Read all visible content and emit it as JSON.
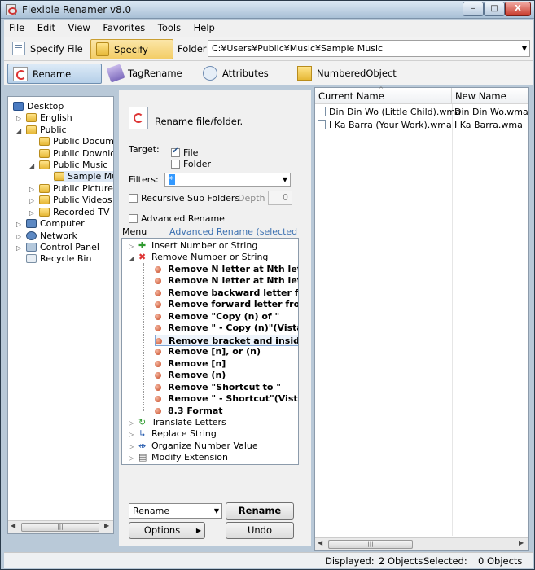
{
  "window": {
    "title": "Flexible Renamer v8.0",
    "min": "–",
    "max": "□",
    "close": "X"
  },
  "menubar": [
    "File",
    "Edit",
    "View",
    "Favorites",
    "Tools",
    "Help"
  ],
  "toolbar": {
    "specify_file": "Specify File",
    "specify_folder": "Specify Folder",
    "folder_label": "Folder",
    "path": "C:¥Users¥Public¥Music¥Sample Music"
  },
  "tabs": [
    "Rename",
    "TagRename",
    "Attributes",
    "NumberedObject"
  ],
  "tree": [
    "Desktop",
    "English",
    "Public",
    "Public Docume",
    "Public Downlo",
    "Public Music",
    "Sample Mu",
    "Public Pictures",
    "Public Videos",
    "Recorded TV",
    "Computer",
    "Network",
    "Control Panel",
    "Recycle Bin"
  ],
  "panel": {
    "header": "Rename file/folder.",
    "target_label": "Target:",
    "target_file": "File",
    "target_folder": "Folder",
    "filters_label": "Filters:",
    "filters_value": "*",
    "recursive": "Recursive Sub Folders",
    "depth_label": "Depth",
    "depth_value": "0",
    "advanced": "Advanced Rename",
    "menu_label": "Menu",
    "menu_selected": "Advanced Rename (selected item)"
  },
  "menu_tree": {
    "insert": "Insert Number or String",
    "remove": "Remove Number or String",
    "remove_items": [
      "Remove N letter at Nth letter",
      "Remove N letter at Nth letter",
      "Remove backward letter from",
      "Remove forward letter from l",
      "Remove \"Copy (n) of \"",
      "Remove \" - Copy (n)\"(Vista)",
      "Remove bracket and inside",
      "Remove [n], or (n)",
      "Remove [n]",
      "Remove (n)",
      "Remove \"Shortcut to \"",
      "Remove \" - Shortcut\"(Vista)",
      "8.3 Format"
    ],
    "translate": "Translate Letters",
    "replace": "Replace String",
    "organize": "Organize Number Value",
    "modify": "Modify Extension"
  },
  "actions": {
    "mode": "Rename",
    "rename_button": "Rename",
    "options_button": "Options",
    "undo_button": "Undo"
  },
  "file_list": {
    "col_current": "Current Name",
    "col_new": "New Name",
    "rows": [
      {
        "current": "Din Din Wo (Little Child).wma",
        "new": "Din Din Wo.wma"
      },
      {
        "current": "I Ka Barra (Your Work).wma",
        "new": "I Ka Barra.wma"
      }
    ]
  },
  "status": {
    "displayed_label": "Displayed:",
    "displayed_value": "2 Objects",
    "selected_label": "Selected:",
    "selected_value": "0 Objects"
  }
}
